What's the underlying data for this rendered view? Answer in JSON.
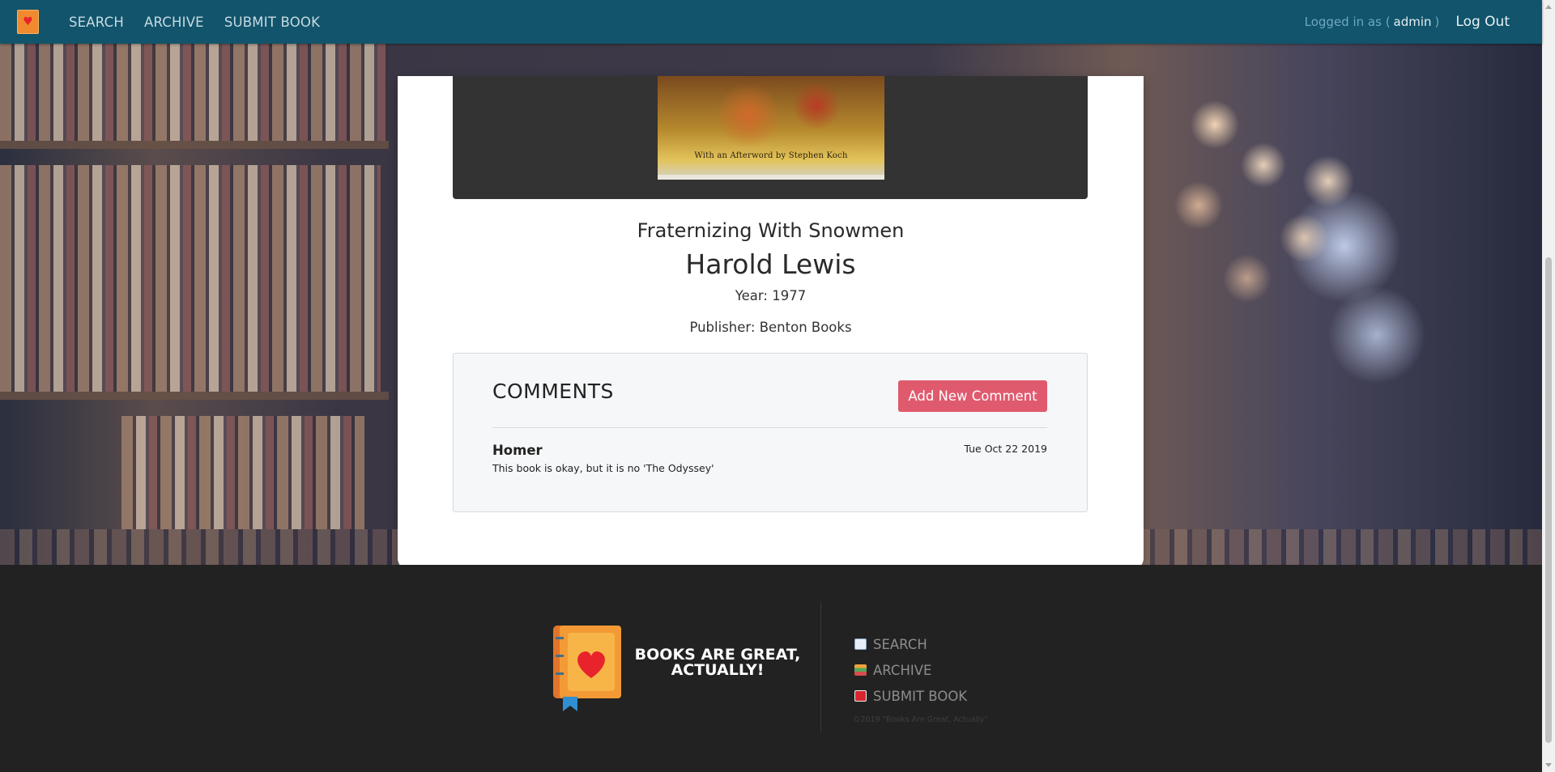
{
  "nav": {
    "logo_icon": "book-heart-icon",
    "links": [
      "SEARCH",
      "ARCHIVE",
      "SUBMIT BOOK"
    ],
    "logged_in_prefix": "Logged in as (",
    "logged_in_user": "admin",
    "logged_in_suffix": ")",
    "logout": "Log Out"
  },
  "book": {
    "cover_caption": "With an Afterword by Stephen Koch",
    "title": "Fraternizing With Snowmen",
    "author": "Harold Lewis",
    "year": "Year: 1977",
    "publisher": "Publisher: Benton Books"
  },
  "comments": {
    "heading": "COMMENTS",
    "add_button": "Add New Comment",
    "items": [
      {
        "author": "Homer",
        "date": "Tue Oct 22 2019",
        "text": "This book is okay, but it is no 'The Odyssey'"
      }
    ]
  },
  "footer": {
    "tagline": "BOOKS ARE GREAT, ACTUALLY!",
    "links": [
      {
        "label": "SEARCH",
        "icon": "open-book-icon"
      },
      {
        "label": "ARCHIVE",
        "icon": "stacked-books-icon"
      },
      {
        "label": "SUBMIT BOOK",
        "icon": "red-book-icon"
      }
    ],
    "copyright": "©2019 \"Books Are Great, Actually\""
  },
  "colors": {
    "navbar": "#11546b",
    "accent_button": "#e05a6e",
    "footer": "#222222",
    "logo_orange": "#f18a2f",
    "heart_red": "#e8232b"
  }
}
